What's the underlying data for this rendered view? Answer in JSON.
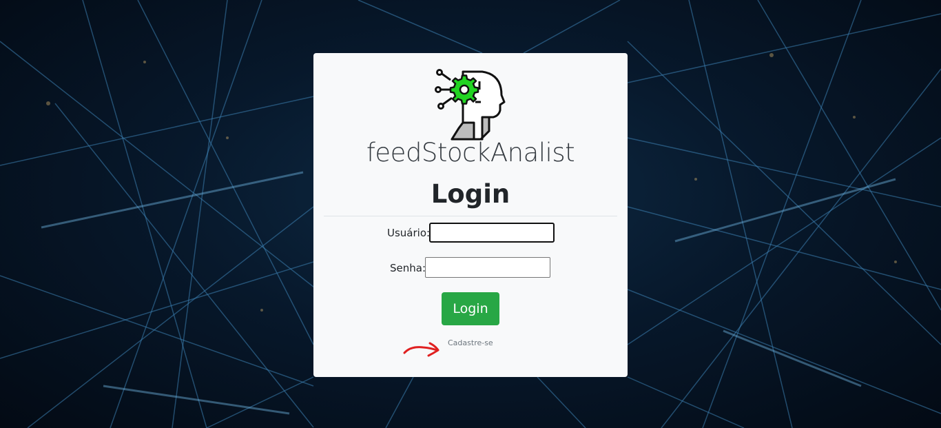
{
  "app": {
    "name": "feedStockAnalist",
    "logo_icon": "ai-head-gear-icon"
  },
  "login": {
    "title": "Login",
    "username_label": "Usuário:",
    "username_value": "",
    "password_label": "Senha:",
    "password_value": "",
    "submit_label": "Login",
    "signup_link": "Cadastre-se"
  },
  "colors": {
    "card_background": "#f8f9fa",
    "button_green": "#28a745",
    "annotation_red": "#e02020",
    "logo_gear_green": "#22d422"
  }
}
